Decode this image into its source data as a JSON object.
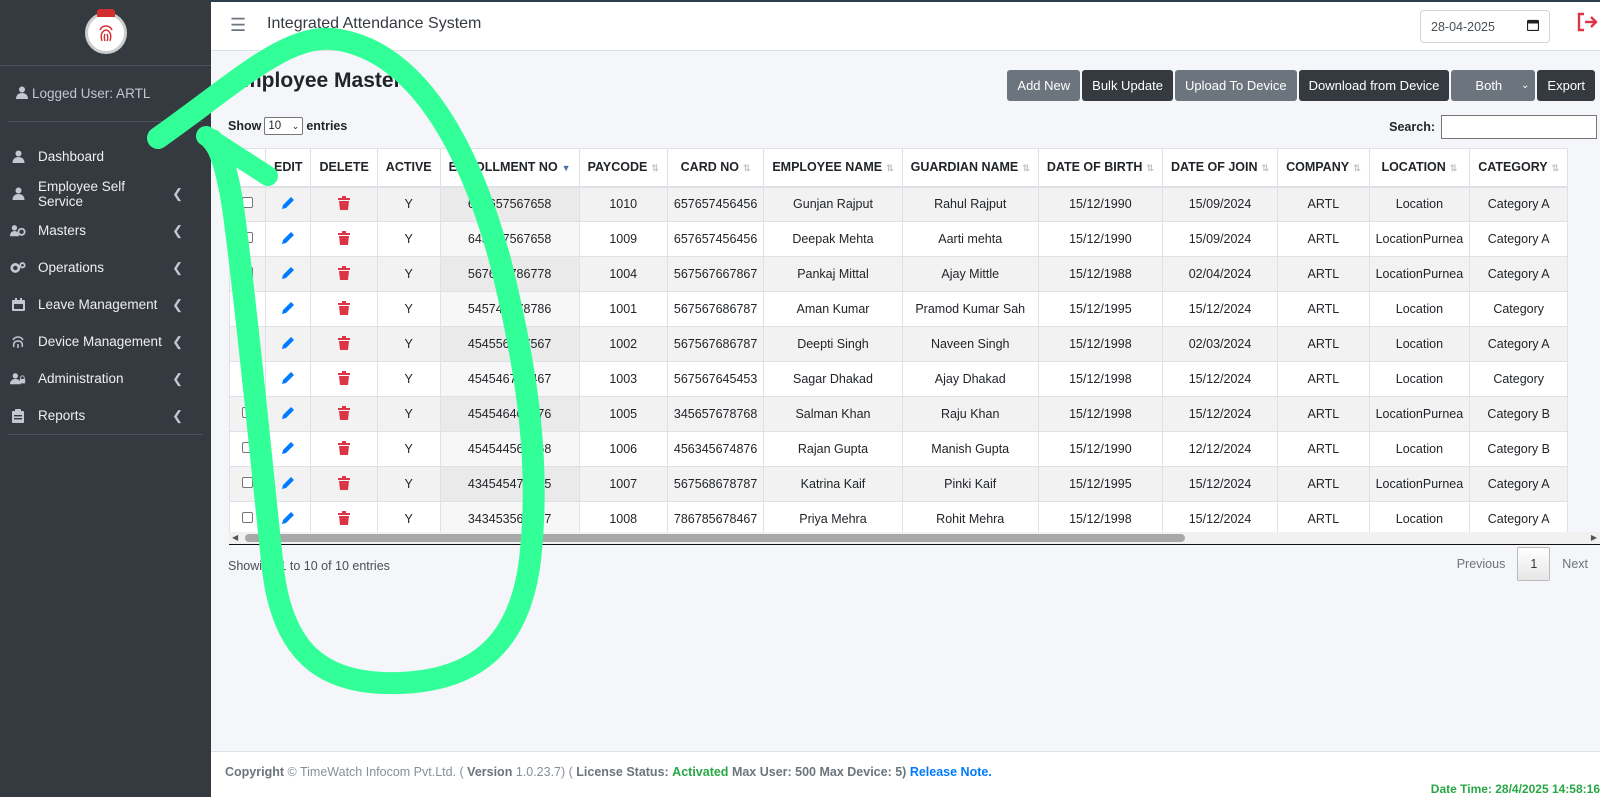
{
  "sidebar": {
    "user_label": "Logged User: ARTL",
    "items": [
      {
        "label": "Dashboard",
        "icon": "dashboard-user-icon"
      },
      {
        "label": "Employee Self Service",
        "icon": "user-icon"
      },
      {
        "label": "Masters",
        "icon": "users-cog-icon"
      },
      {
        "label": "Operations",
        "icon": "cogs-icon"
      },
      {
        "label": "Leave Management",
        "icon": "calendar-icon"
      },
      {
        "label": "Device Management",
        "icon": "fingerprint-icon"
      },
      {
        "label": "Administration",
        "icon": "user-lock-icon"
      },
      {
        "label": "Reports",
        "icon": "clipboard-icon"
      }
    ]
  },
  "header": {
    "title": "Integrated Attendance System",
    "date": "28-04-2025"
  },
  "main": {
    "page_title": "Employee Master",
    "buttons": {
      "add_new": "Add New",
      "bulk_update": "Bulk Update",
      "upload": "Upload To Device",
      "download": "Download from Device",
      "select_value": "Both",
      "export": "Export"
    },
    "show": "Show",
    "entries_value": "10",
    "entries": "entries",
    "search_label": "Search:",
    "columns": [
      "",
      "EDIT",
      "DELETE",
      "ACTIVE",
      "ENROLLMENT NO",
      "PAYCODE",
      "CARD NO",
      "EMPLOYEE NAME",
      "GUARDIAN NAME",
      "DATE OF BIRTH",
      "DATE OF JOIN",
      "COMPANY",
      "LOCATION",
      "CATEGORY"
    ],
    "rows": [
      [
        "Y",
        "645657567658",
        "1010",
        "657657456456",
        "Gunjan Rajput",
        "Rahul Rajput",
        "15/12/1990",
        "15/09/2024",
        "ARTL",
        "Location",
        "Category A"
      ],
      [
        "Y",
        "645657567658",
        "1009",
        "657657456456",
        "Deepak Mehta",
        "Aarti mehta",
        "15/12/1990",
        "15/09/2024",
        "ARTL",
        "LocationPurnea",
        "Category A"
      ],
      [
        "Y",
        "567686786778",
        "1004",
        "567567667867",
        "Pankaj Mittal",
        "Ajay Mittle",
        "15/12/1988",
        "02/04/2024",
        "ARTL",
        "LocationPurnea",
        "Category A"
      ],
      [
        "Y",
        "545745678786",
        "1001",
        "567567686787",
        "Aman Kumar",
        "Pramod Kumar Sah",
        "15/12/1995",
        "15/12/2024",
        "ARTL",
        "Location",
        "Category"
      ],
      [
        "Y",
        "454556767567",
        "1002",
        "567567686787",
        "Deepti Singh",
        "Naveen Singh",
        "15/12/1998",
        "02/03/2024",
        "ARTL",
        "Location",
        "Category A"
      ],
      [
        "Y",
        "454546756467",
        "1003",
        "567567645453",
        "Sagar Dhakad",
        "Ajay Dhakad",
        "15/12/1998",
        "15/12/2024",
        "ARTL",
        "Location",
        "Category"
      ],
      [
        "Y",
        "454546467676",
        "1005",
        "345657678768",
        "Salman Khan",
        "Raju Khan",
        "15/12/1998",
        "15/12/2024",
        "ARTL",
        "LocationPurnea",
        "Category B"
      ],
      [
        "Y",
        "454544567468",
        "1006",
        "456345674876",
        "Rajan Gupta",
        "Manish Gupta",
        "15/12/1990",
        "12/12/2024",
        "ARTL",
        "Location",
        "Category B"
      ],
      [
        "Y",
        "434545475675",
        "1007",
        "567568678787",
        "Katrina Kaif",
        "Pinki Kaif",
        "15/12/1995",
        "15/12/2024",
        "ARTL",
        "LocationPurnea",
        "Category A"
      ],
      [
        "Y",
        "343453565787",
        "1008",
        "786785678467",
        "Priya Mehra",
        "Rohit Mehra",
        "15/12/1998",
        "15/12/2024",
        "ARTL",
        "Location",
        "Category A"
      ]
    ],
    "info": "Showing 1 to 10 of 10 entries",
    "pager": {
      "prev": "Previous",
      "current": "1",
      "next": "Next"
    }
  },
  "footer": {
    "copyright_label": "Copyright",
    "copyright_text": "© TimeWatch Infocom Pvt.Ltd. (",
    "version_label": "Version",
    "version": "1.0.23.7) (",
    "license_label": "License Status:",
    "license_status": "Activated",
    "max_text": "Max User: 500 Max Device: 5)",
    "release": "Release Note.",
    "datetime": "Date Time: 28/4/2025 14:58:16"
  },
  "colors": {
    "sidebar": "#343a40",
    "annotation": "#33ff99",
    "primary": "#007bff",
    "danger": "#dc3545"
  }
}
